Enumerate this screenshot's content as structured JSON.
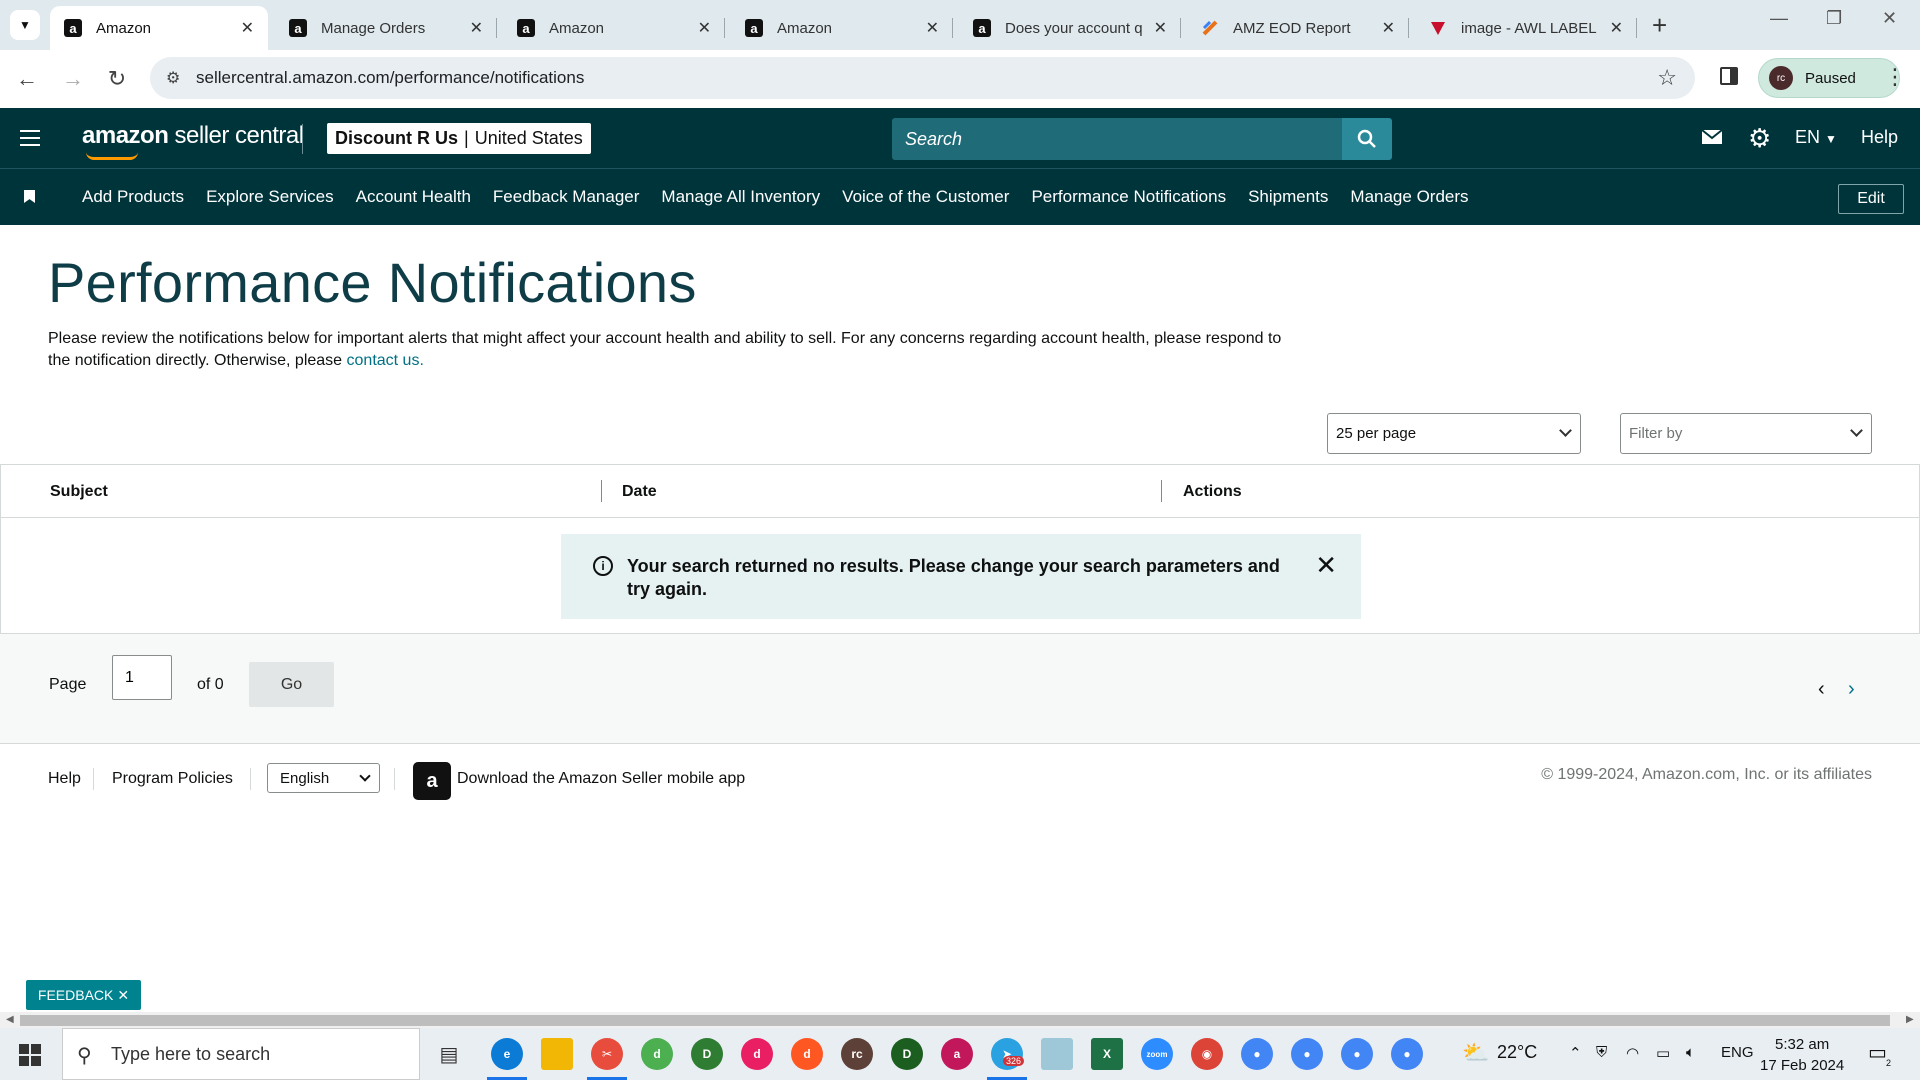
{
  "browser": {
    "tabs": [
      {
        "title": "Amazon",
        "active": true
      },
      {
        "title": "Manage Orders"
      },
      {
        "title": "Amazon"
      },
      {
        "title": "Amazon"
      },
      {
        "title": "Does your account q"
      },
      {
        "title": "AMZ EOD Report"
      },
      {
        "title": "image - AWL LABEL"
      }
    ],
    "url": "sellercentral.amazon.com/performance/notifications",
    "profile_status": "Paused",
    "profile_initials": "rc"
  },
  "header": {
    "logo_text_bold": "amazon",
    "logo_text": "seller central",
    "store_name": "Discount R Us",
    "store_region": "United States",
    "search_placeholder": "Search",
    "lang": "EN",
    "help": "Help"
  },
  "nav": {
    "links": [
      "Add Products",
      "Explore Services",
      "Account Health",
      "Feedback Manager",
      "Manage All Inventory",
      "Voice of the Customer",
      "Performance Notifications",
      "Shipments",
      "Manage Orders"
    ],
    "edit": "Edit"
  },
  "main": {
    "title": "Performance Notifications",
    "intro": "Please review the notifications below for important alerts that might affect your account health and ability to sell. For any concerns regarding account health, please respond to the notification directly. Otherwise, please ",
    "contact_link": "contact us.",
    "per_page": "25 per page",
    "filter_placeholder": "Filter by",
    "columns": [
      "Subject",
      "Date",
      "Actions"
    ],
    "alert": "Your search returned no results. Please change your search parameters and try again.",
    "pager": {
      "page_label": "Page",
      "page_value": "1",
      "of_label": "of 0",
      "go": "Go"
    }
  },
  "footer": {
    "help": "Help",
    "policies": "Program Policies",
    "language": "English",
    "app_download": "Download the Amazon Seller mobile app",
    "copyright": "© 1999-2024, Amazon.com, Inc. or its affiliates"
  },
  "feedback": "FEEDBACK",
  "taskbar": {
    "search_placeholder": "Type here to search",
    "weather": "22°C",
    "lang": "ENG",
    "time": "5:32 am",
    "date": "17 Feb 2024",
    "telegram_badge": "326",
    "notif_count": "2"
  },
  "colors": {
    "header_bg": "#00343b",
    "link": "#007185",
    "alert_bg": "#e6f1f2",
    "title": "#0f3d47"
  }
}
